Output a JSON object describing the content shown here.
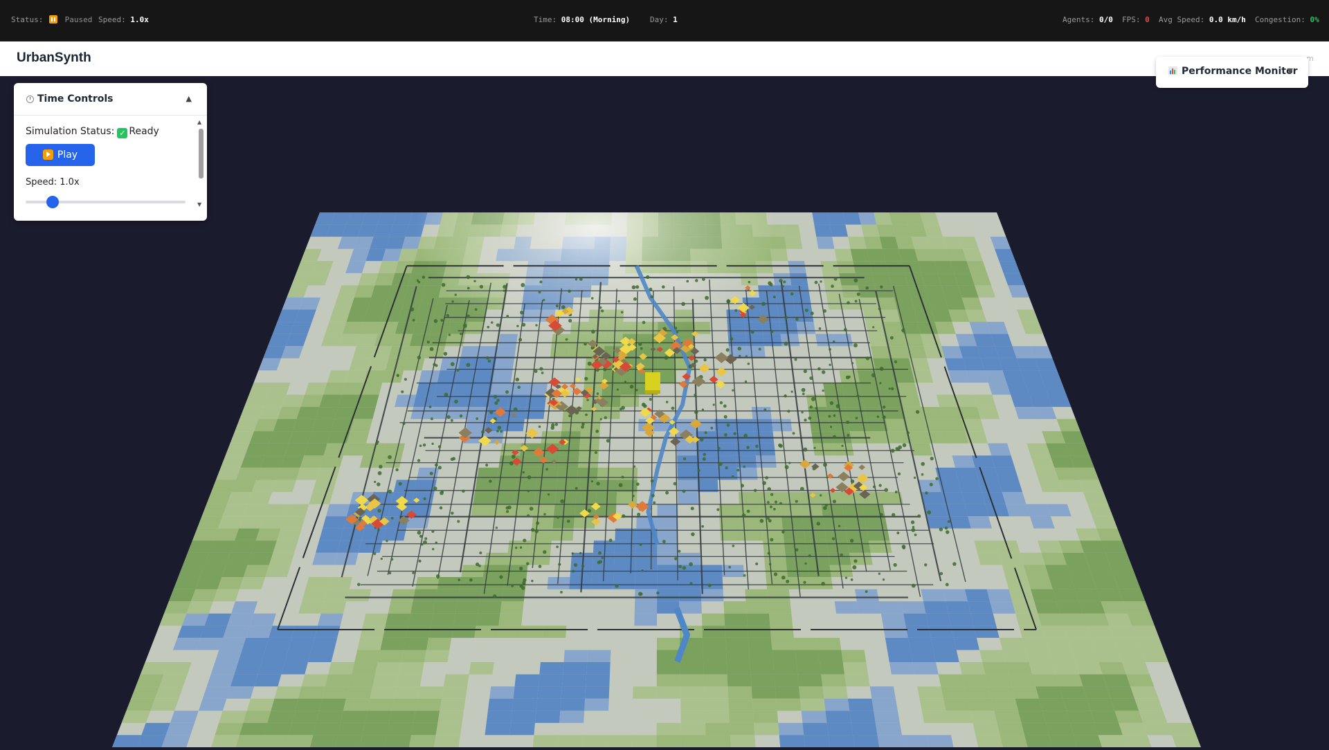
{
  "statusbar": {
    "status_label": "Status:",
    "status_value": "Paused",
    "speed_label": "Speed:",
    "speed_value": "1.0x",
    "time_label": "Time:",
    "time_value": "08:00 (Morning)",
    "day_label": "Day:",
    "day_value": "1",
    "agents_label": "Agents:",
    "agents_value": "0/0",
    "fps_label": "FPS:",
    "fps_value": "0",
    "avg_speed_label": "Avg Speed:",
    "avg_speed_value": "0.0 km/h",
    "congestion_label": "Congestion:",
    "congestion_value": "0%"
  },
  "header": {
    "title": "UrbanSynth",
    "hint": "m"
  },
  "perf_monitor": {
    "label": "Performance Monitor",
    "chevron": "▼"
  },
  "time_controls": {
    "title": "Time Controls",
    "collapse_glyph": "▲",
    "status_label": "Simulation Status:",
    "status_value": "Ready",
    "play_label": "Play",
    "speed_text": "Speed: 1.0x",
    "speed_slider_fraction": 0.17
  },
  "colors": {
    "accent": "#2563eb",
    "bg": "#1b1b2e",
    "warning": "#f59e0b",
    "success": "#22c55e",
    "danger": "#ef4444"
  }
}
